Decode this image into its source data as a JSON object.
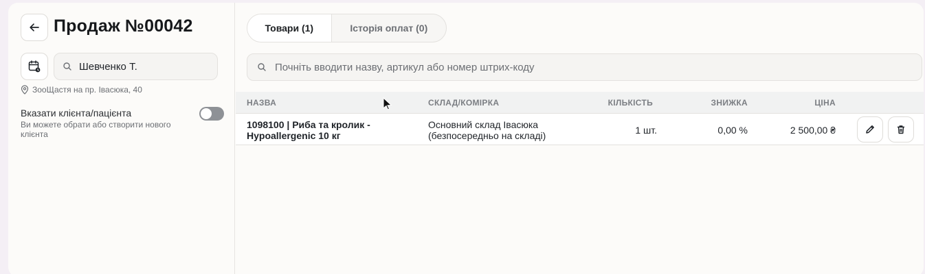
{
  "header": {
    "title": "Продаж №00042"
  },
  "client": {
    "search_value": "Шевченко Т.",
    "location": "ЗооЩастя на пр. Івасюка, 40",
    "toggle_label": "Вказати клієнта/пацієнта",
    "toggle_hint": "Ви можете обрати або створити нового клієнта",
    "toggle_on": false
  },
  "tabs": [
    {
      "label": "Товари (1)",
      "active": true
    },
    {
      "label": "Історія оплат (0)",
      "active": false
    }
  ],
  "product_search": {
    "placeholder": "Почніть вводити назву, артикул або номер штрих-коду"
  },
  "table": {
    "columns": {
      "name": "НАЗВА",
      "store": "СКЛАД/КОМІРКА",
      "qty": "КІЛЬКІСТЬ",
      "discount": "ЗНИЖКА",
      "price": "ЦІНА"
    },
    "rows": [
      {
        "name": "1098100 | Риба та кролик - Hypoallergenic 10 кг",
        "store": "Основний склад Івасюка (безпосередньо на складі)",
        "qty": "1 шт.",
        "discount": "0,00 %",
        "price": "2 500,00 ₴"
      }
    ]
  },
  "icons": {
    "back": "arrow-left-icon",
    "calendar": "calendar-icon",
    "search": "search-icon",
    "location": "location-pin-icon",
    "edit": "pencil-icon",
    "delete": "trash-icon"
  }
}
